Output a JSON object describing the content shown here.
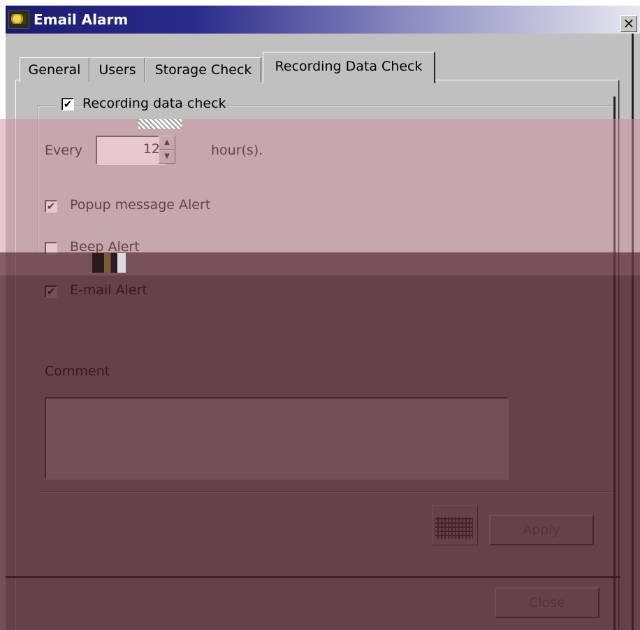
{
  "window": {
    "title": "Email Alarm",
    "close_glyph": "×",
    "icon": "app-camera-icon"
  },
  "tabs": [
    {
      "label": "General",
      "active": false
    },
    {
      "label": "Users",
      "active": false
    },
    {
      "label": "Storage Check",
      "active": false
    },
    {
      "label": "Recording Data Check",
      "active": true
    }
  ],
  "group": {
    "checkbox_checked": true,
    "label": "Recording data check"
  },
  "every": {
    "label": "Every",
    "value": "12",
    "unit": "hour(s)."
  },
  "options": [
    {
      "label": "Popup message Alert",
      "checked": true
    },
    {
      "label": "Beep Alert",
      "checked": false
    },
    {
      "label": "E-mail Alert",
      "checked": true
    }
  ],
  "comment": {
    "label": "Comment",
    "value": ""
  },
  "buttons": {
    "keyboard_icon": "keyboard-icon",
    "apply": "Apply",
    "close": "Close"
  },
  "colors": {
    "title_bar_start": "#1b1c6e",
    "face": "#c0c0c0",
    "overlay_light": "#d9b9bd",
    "overlay_dark": "#573840"
  }
}
